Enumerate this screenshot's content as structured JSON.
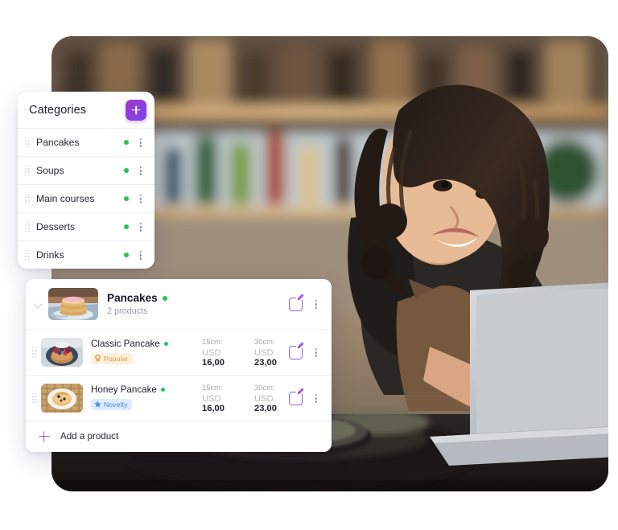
{
  "categories_panel": {
    "title": "Categories",
    "add_button_label": "+",
    "add_button_icon": "plus-icon",
    "items": [
      {
        "label": "Pancakes",
        "status": "active",
        "drag_icon": "drag-handle-icon",
        "menu_icon": "kebab-menu-icon"
      },
      {
        "label": "Soups",
        "status": "active",
        "drag_icon": "drag-handle-icon",
        "menu_icon": "kebab-menu-icon"
      },
      {
        "label": "Main courses",
        "status": "active",
        "drag_icon": "drag-handle-icon",
        "menu_icon": "kebab-menu-icon"
      },
      {
        "label": "Desserts",
        "status": "active",
        "drag_icon": "drag-handle-icon",
        "menu_icon": "kebab-menu-icon"
      },
      {
        "label": "Drinks",
        "status": "active",
        "drag_icon": "drag-handle-icon",
        "menu_icon": "kebab-menu-icon"
      }
    ]
  },
  "products_panel": {
    "group": {
      "name": "Pancakes",
      "subtitle": "2 products",
      "collapse_icon": "chevron-down-icon",
      "thumb_icon": "pancake-stack-thumbnail",
      "edit_icon": "edit-pencil-icon",
      "menu_icon": "kebab-menu-icon",
      "status": "active"
    },
    "products": [
      {
        "name": "Classic Pancake",
        "status": "active",
        "badge": {
          "text": "Popular",
          "icon": "award-ribbon-icon",
          "color": "#e09a3c",
          "background": "#fdf0dd"
        },
        "thumb_icon": "berry-pancake-thumbnail",
        "drag_icon": "drag-handle-icon",
        "edit_icon": "edit-pencil-icon",
        "menu_icon": "kebab-menu-icon",
        "prices": [
          {
            "size": "15cm:",
            "currency": "USD",
            "amount": "16,00"
          },
          {
            "size": "30cm:",
            "currency": "USD",
            "amount": "23,00"
          }
        ]
      },
      {
        "name": "Honey Pancake",
        "status": "active",
        "badge": {
          "text": "Novelty",
          "icon": "star-icon",
          "color": "#3d8fe0",
          "background": "#ddecfd"
        },
        "thumb_icon": "honey-pancake-thumbnail",
        "drag_icon": "drag-handle-icon",
        "edit_icon": "edit-pencil-icon",
        "menu_icon": "kebab-menu-icon",
        "prices": [
          {
            "size": "15cm:",
            "currency": "USD",
            "amount": "16,00"
          },
          {
            "size": "30cm:",
            "currency": "USD",
            "amount": "23,00"
          }
        ]
      }
    ],
    "add_product": {
      "label": "Add a product",
      "icon": "plus-icon"
    }
  },
  "background_photo": {
    "alt": "Woman in apron working at a laptop behind a cafe bar counter",
    "icon": "cafe-owner-laptop-photo"
  },
  "colors": {
    "accent_purple": "#8b3fe0",
    "status_green": "#23c552",
    "popular_orange": "#e09a3c",
    "novelty_blue": "#3d8fe0",
    "panel_white": "#ffffff"
  }
}
